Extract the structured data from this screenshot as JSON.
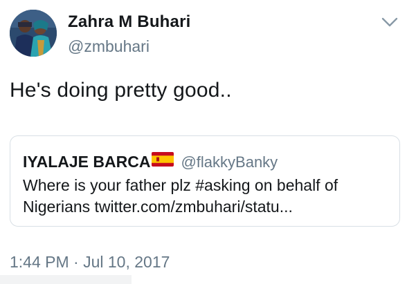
{
  "author": {
    "display_name": "Zahra M Buhari",
    "handle": "@zmbuhari"
  },
  "tweet": {
    "text": "He's doing pretty good.."
  },
  "quoted_tweet": {
    "display_name": "IYALAJE BARCA",
    "flag_icon": "spain-flag-icon",
    "handle": "@flakkyBanky",
    "text_line1": "Where is your father plz #asking on behalf of",
    "text_line2": "Nigerians twitter.com/zmbuhari/statu..."
  },
  "meta": {
    "timestamp": "1:44 PM · Jul 10, 2017"
  },
  "icons": {
    "menu": "chevron-down-icon"
  },
  "colors": {
    "text_primary": "#14171a",
    "text_secondary": "#657786",
    "border": "#d8dfe5"
  }
}
